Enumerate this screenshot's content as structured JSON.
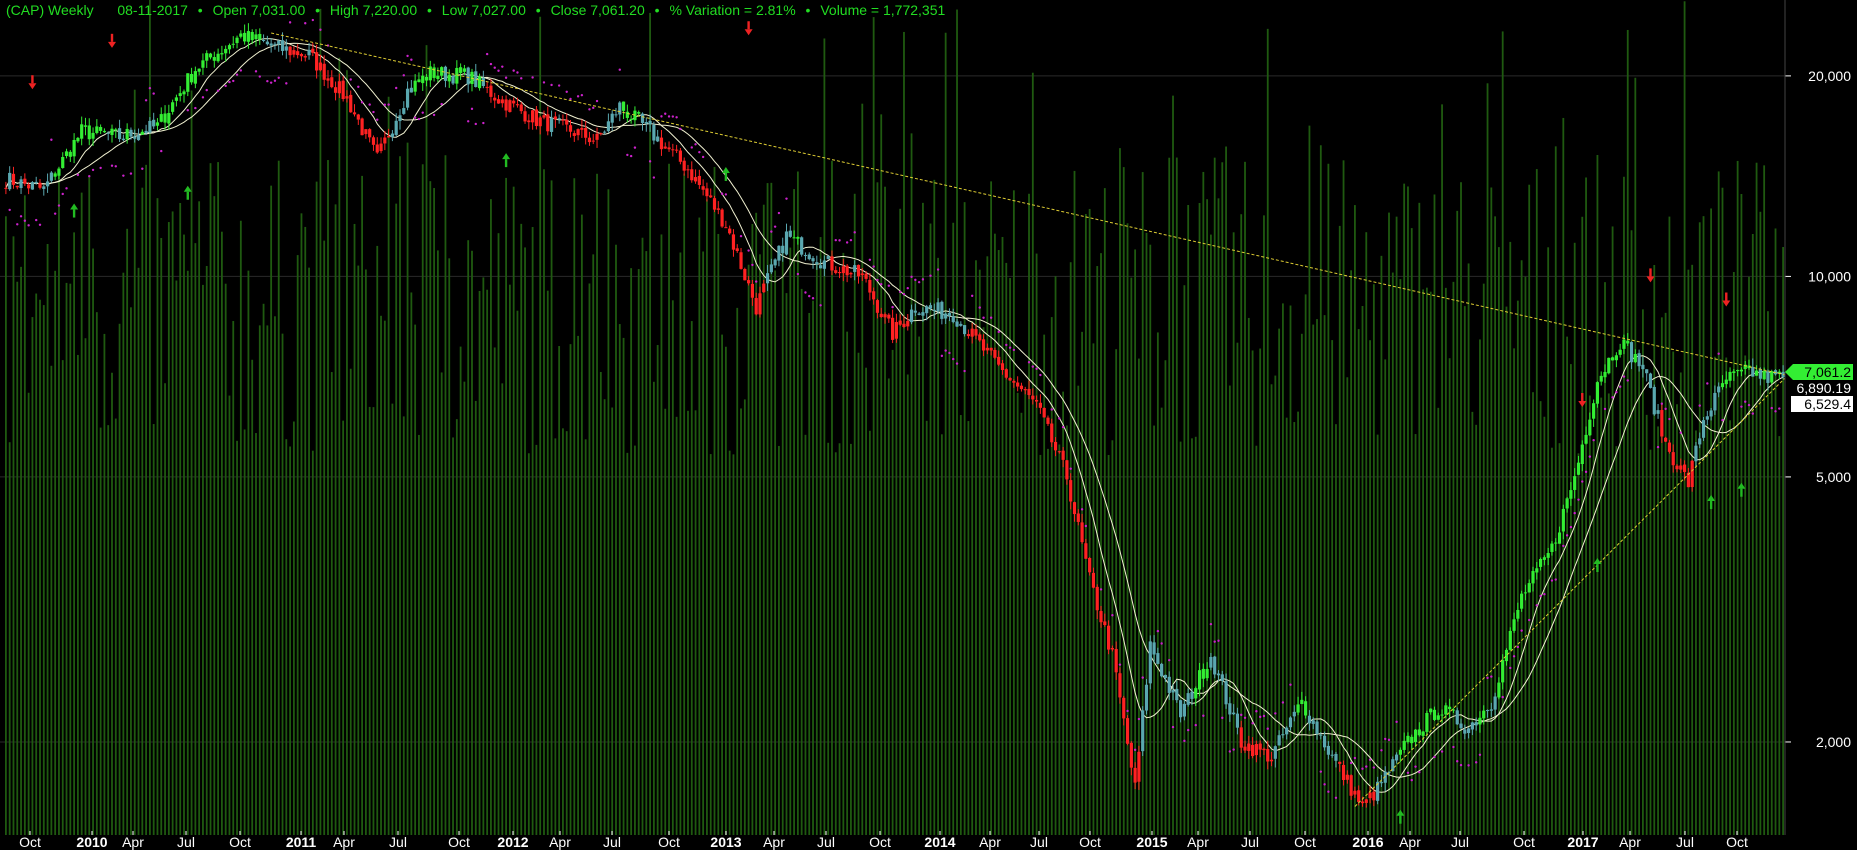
{
  "header": {
    "symbol": "(CAP) Weekly",
    "date": "08-11-2017",
    "open": "Open 7,031.00",
    "high": "High 7,220.00",
    "low": "Low 7,027.00",
    "close": "Close 7,061.20",
    "variation": "% Variation = 2.81%",
    "volume": "Volume = 1,772,351"
  },
  "colors": {
    "background": "#000000",
    "up_candle": "#33ee33",
    "down_candle": "#ff2222",
    "neutral_candle": "#5aa8b0",
    "volume": "#1f5a10",
    "moving_average": "#f0f0d0",
    "sar_dots": "#cc22cc",
    "trendline": "#ddcc33",
    "axis_text": "#ffffff",
    "grid": "#2a2a2a"
  },
  "chart_data": {
    "type": "candlestick",
    "title": "(CAP) Weekly",
    "y_scale": "log",
    "ylim": [
      1450,
      26000
    ],
    "y_ticks": [
      {
        "value": 2000,
        "label": "2,000"
      },
      {
        "value": 5000,
        "label": "5,000"
      },
      {
        "value": 10000,
        "label": "10,000"
      },
      {
        "value": 20000,
        "label": "20,000"
      }
    ],
    "x_ticks": [
      {
        "label": "Oct",
        "major": false
      },
      {
        "label": "2010",
        "major": true
      },
      {
        "label": "Apr",
        "major": false
      },
      {
        "label": "Jul",
        "major": false
      },
      {
        "label": "Oct",
        "major": false
      },
      {
        "label": "2011",
        "major": true
      },
      {
        "label": "Apr",
        "major": false
      },
      {
        "label": "Jul",
        "major": false
      },
      {
        "label": "Oct",
        "major": false
      },
      {
        "label": "2012",
        "major": true
      },
      {
        "label": "Apr",
        "major": false
      },
      {
        "label": "Jul",
        "major": false
      },
      {
        "label": "Oct",
        "major": false
      },
      {
        "label": "2013",
        "major": true
      },
      {
        "label": "Apr",
        "major": false
      },
      {
        "label": "Jul",
        "major": false
      },
      {
        "label": "Oct",
        "major": false
      },
      {
        "label": "2014",
        "major": true
      },
      {
        "label": "Apr",
        "major": false
      },
      {
        "label": "Jul",
        "major": false
      },
      {
        "label": "Oct",
        "major": false
      },
      {
        "label": "2015",
        "major": true
      },
      {
        "label": "Apr",
        "major": false
      },
      {
        "label": "Jul",
        "major": false
      },
      {
        "label": "Oct",
        "major": false
      },
      {
        "label": "2016",
        "major": true
      },
      {
        "label": "Apr",
        "major": false
      },
      {
        "label": "Jul",
        "major": false
      },
      {
        "label": "Oct",
        "major": false
      },
      {
        "label": "2017",
        "major": true
      },
      {
        "label": "Apr",
        "major": false
      },
      {
        "label": "Jul",
        "major": false
      },
      {
        "label": "Oct",
        "major": false
      }
    ],
    "price_anchors": [
      [
        0,
        14000
      ],
      [
        10,
        13500
      ],
      [
        20,
        16500
      ],
      [
        30,
        16200
      ],
      [
        40,
        16800
      ],
      [
        50,
        20500
      ],
      [
        62,
        23000
      ],
      [
        72,
        22000
      ],
      [
        80,
        21500
      ],
      [
        90,
        18500
      ],
      [
        98,
        15000
      ],
      [
        106,
        19000
      ],
      [
        112,
        20200
      ],
      [
        122,
        20000
      ],
      [
        130,
        18500
      ],
      [
        140,
        17200
      ],
      [
        150,
        16500
      ],
      [
        156,
        16000
      ],
      [
        162,
        18000
      ],
      [
        170,
        16500
      ],
      [
        180,
        14500
      ],
      [
        190,
        12000
      ],
      [
        198,
        9000
      ],
      [
        206,
        11500
      ],
      [
        216,
        10500
      ],
      [
        226,
        10000
      ],
      [
        234,
        8200
      ],
      [
        240,
        9000
      ],
      [
        250,
        8800
      ],
      [
        262,
        7300
      ],
      [
        272,
        6400
      ],
      [
        280,
        5000
      ],
      [
        286,
        3500
      ],
      [
        292,
        2700
      ],
      [
        298,
        1700
      ],
      [
        302,
        2800
      ],
      [
        310,
        2200
      ],
      [
        318,
        2700
      ],
      [
        326,
        2000
      ],
      [
        334,
        1900
      ],
      [
        342,
        2300
      ],
      [
        350,
        1900
      ],
      [
        358,
        1600
      ],
      [
        362,
        1700
      ],
      [
        370,
        2000
      ],
      [
        378,
        2250
      ],
      [
        386,
        2100
      ],
      [
        392,
        2300
      ],
      [
        400,
        3300
      ],
      [
        408,
        3900
      ],
      [
        414,
        5000
      ],
      [
        420,
        7000
      ],
      [
        426,
        8000
      ],
      [
        432,
        7300
      ],
      [
        438,
        5600
      ],
      [
        444,
        4900
      ],
      [
        448,
        6100
      ],
      [
        454,
        7000
      ],
      [
        460,
        7200
      ],
      [
        464,
        7061.2
      ]
    ],
    "overlays": {
      "moving_averages": 2,
      "parabolic_sar": true,
      "trendline": {
        "from": [
          70,
          23200
        ],
        "to": [
          468,
          7150
        ]
      },
      "support_line": {
        "from": [
          356,
          1600
        ],
        "to": [
          468,
          6900
        ]
      }
    },
    "signals": {
      "sell": [
        [
          7,
          19500
        ],
        [
          28,
          22500
        ],
        [
          196,
          23500
        ],
        [
          434,
          10000
        ],
        [
          416,
          6500
        ],
        [
          454,
          9200
        ]
      ],
      "buy": [
        [
          18,
          12600
        ],
        [
          48,
          13400
        ],
        [
          132,
          15000
        ],
        [
          190,
          14300
        ],
        [
          368,
          1550
        ],
        [
          420,
          3700
        ],
        [
          450,
          4600
        ],
        [
          458,
          4800
        ]
      ]
    },
    "last_values": [
      {
        "label": "7,061.2",
        "value": 7061.2,
        "bg": "#33ee33",
        "fg": "#000000"
      },
      {
        "label": "6,890.19",
        "value": 6890.19,
        "bg": "#000000",
        "fg": "#ffffff"
      },
      {
        "label": "6,529.4",
        "value": 6529.4,
        "bg": "#ffffff",
        "fg": "#000000"
      }
    ]
  }
}
